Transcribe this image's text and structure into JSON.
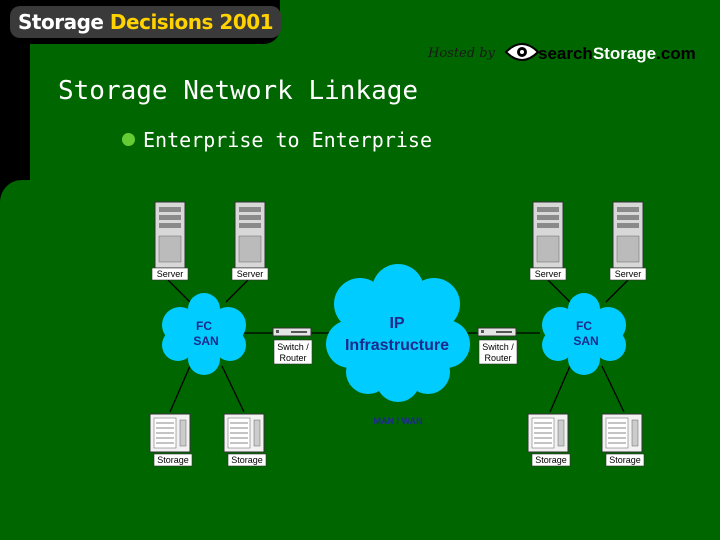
{
  "header": {
    "brand_part1": "Storage ",
    "brand_part2": "Decisions 2001",
    "hosted_by": "Hosted by",
    "sponsor_part1": "search",
    "sponsor_part2": "Storage",
    "sponsor_part3": ".com"
  },
  "slide": {
    "title": "Storage Network Linkage",
    "bullet": "Enterprise to Enterprise"
  },
  "diagram": {
    "left_servers": [
      "Server",
      "Server"
    ],
    "right_servers": [
      "Server",
      "Server"
    ],
    "left_san": [
      "FC",
      "SAN"
    ],
    "right_san": [
      "FC",
      "SAN"
    ],
    "left_switch": [
      "Switch /",
      "Router"
    ],
    "right_switch": [
      "Switch /",
      "Router"
    ],
    "cloud": [
      "IP",
      "Infrastructure"
    ],
    "wan_label": "MAN / WAN",
    "left_storage": [
      "Storage",
      "Storage"
    ],
    "right_storage": [
      "Storage",
      "Storage"
    ]
  },
  "colors": {
    "background": "#006600",
    "cloud": "#00ccff",
    "node_text": "#1c2a8c",
    "bullet": "#66cc33",
    "brand_accent": "#ffd200"
  }
}
